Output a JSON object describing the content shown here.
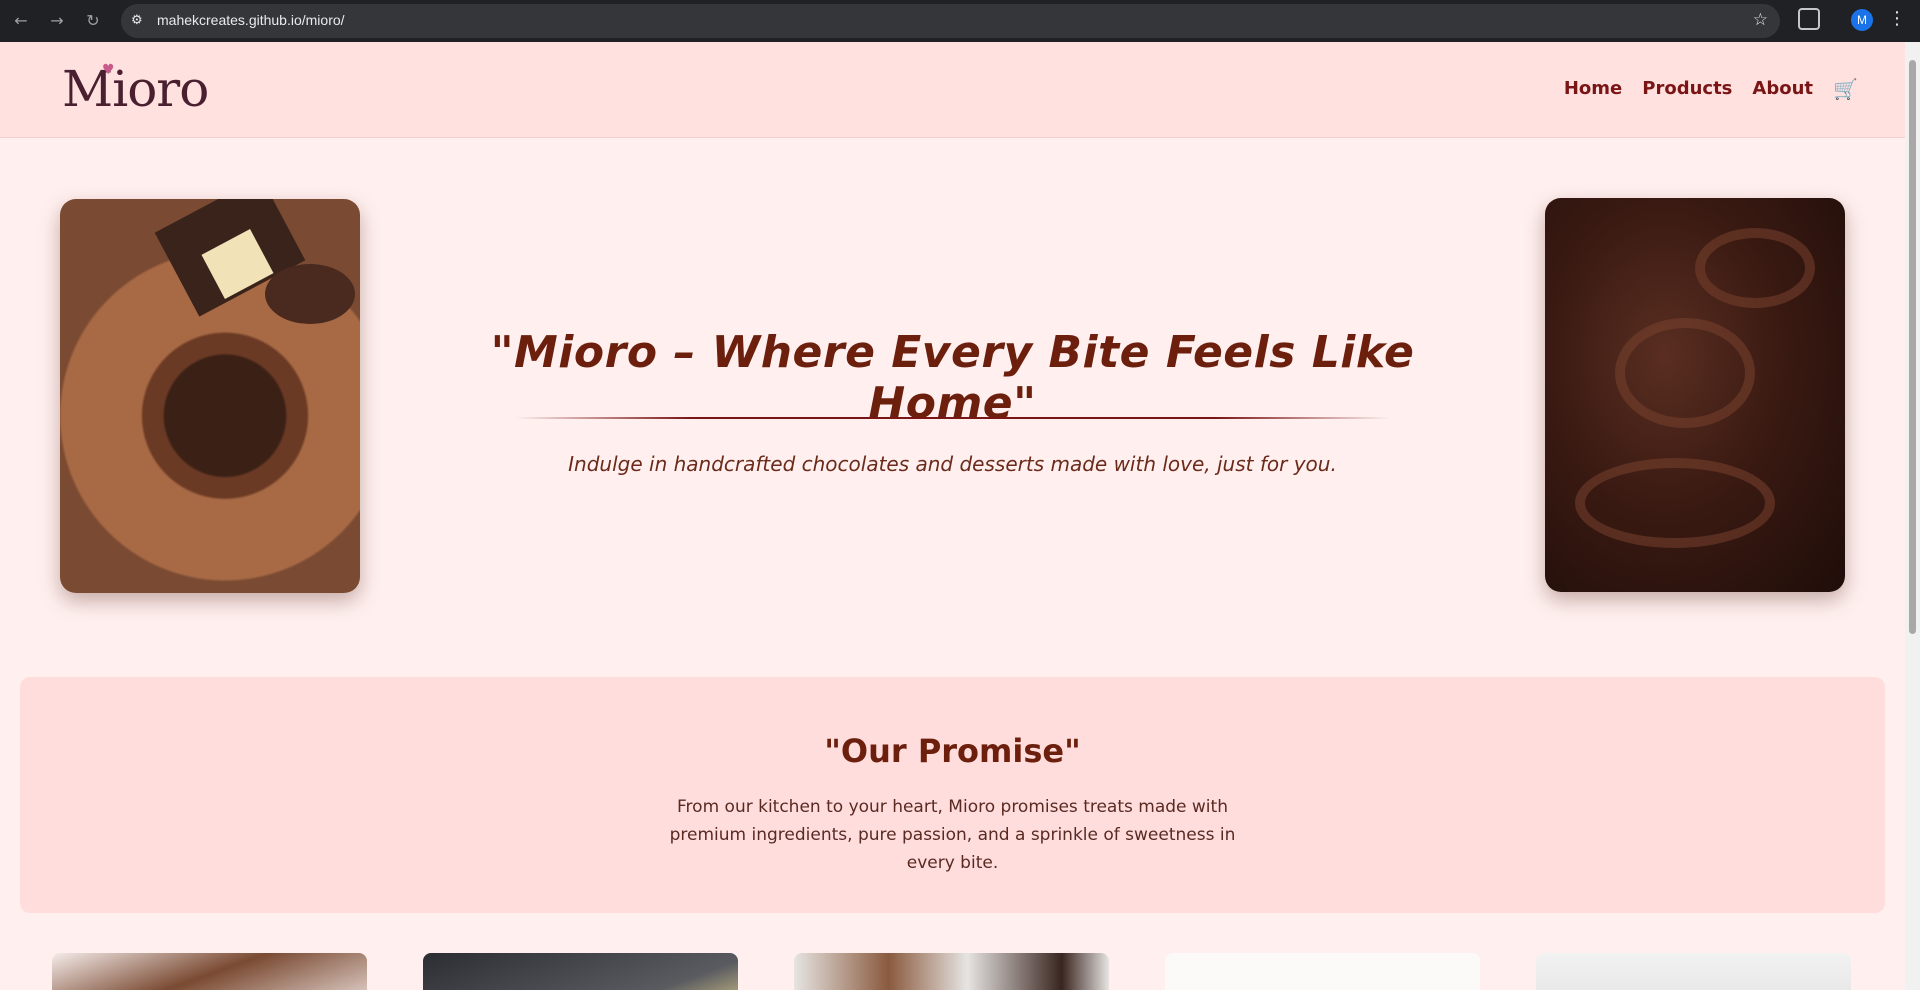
{
  "browser": {
    "url": "mahekcreates.github.io/mioro/",
    "profile_initial": "M"
  },
  "site": {
    "logo_text": "Mioro",
    "nav": {
      "home": "Home",
      "products": "Products",
      "about": "About"
    }
  },
  "hero": {
    "title": "\"Mioro – Where Every Bite Feels Like Home\"",
    "subtitle": "Indulge in handcrafted chocolates and desserts made with love, just for you."
  },
  "promise": {
    "heading": "\"Our Promise\"",
    "text": "From our kitchen to your heart, Mioro promises treats made with premium ingredients, pure passion, and a sprinkle of sweetness in every bite."
  },
  "colors": {
    "header_bg": "#ffe1e0",
    "page_bg": "#fff0ef",
    "accent": "#7a1515",
    "cart": "#a0141e"
  },
  "icons": [
    "back-icon",
    "forward-icon",
    "reload-icon",
    "site-settings-icon",
    "bookmark-star-icon",
    "extensions-icon",
    "menu-icon",
    "cart-icon"
  ]
}
